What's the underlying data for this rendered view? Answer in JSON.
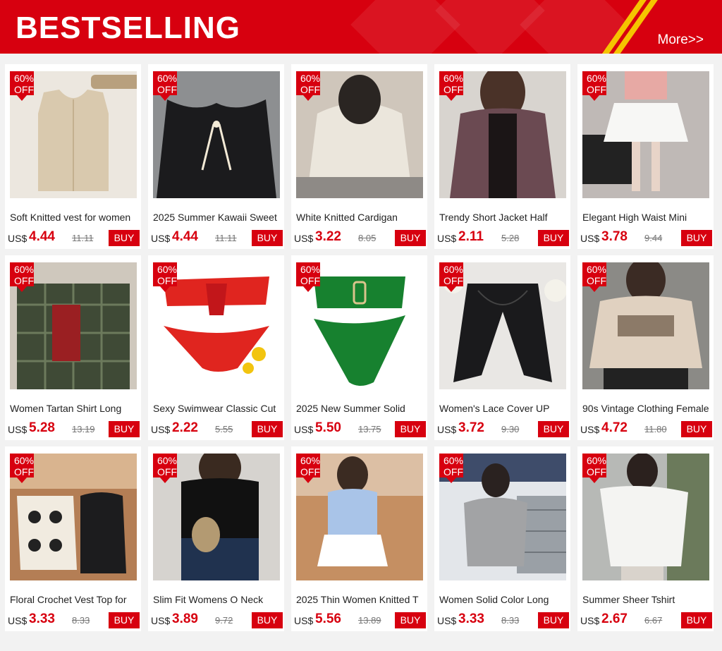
{
  "header": {
    "title": "BESTSELLING",
    "more_label": "More>>"
  },
  "colors": {
    "brand_red": "#d7000f",
    "accent_yellow": "#f5c400"
  },
  "badge": {
    "line1": "60%",
    "line2": "OFF"
  },
  "currency": "US$",
  "buy_label": "BUY",
  "products": [
    {
      "title": "Soft Knitted vest for women",
      "price": "4.44",
      "original_price": "11.11"
    },
    {
      "title": "2025 Summer Kawaii Sweet",
      "price": "4.44",
      "original_price": "11.11"
    },
    {
      "title": "White Knitted Cardigan",
      "price": "3.22",
      "original_price": "8.05"
    },
    {
      "title": "Trendy Short Jacket Half",
      "price": "2.11",
      "original_price": "5.28"
    },
    {
      "title": "Elegant High Waist Mini",
      "price": "3.78",
      "original_price": "9.44"
    },
    {
      "title": "Women Tartan Shirt Long",
      "price": "5.28",
      "original_price": "13.19"
    },
    {
      "title": "Sexy Swimwear Classic Cut",
      "price": "2.22",
      "original_price": "5.55"
    },
    {
      "title": "2025 New Summer Solid",
      "price": "5.50",
      "original_price": "13.75"
    },
    {
      "title": "Women's Lace Cover UP",
      "price": "3.72",
      "original_price": "9.30"
    },
    {
      "title": "90s Vintage Clothing Female",
      "price": "4.72",
      "original_price": "11.80"
    },
    {
      "title": "Floral Crochet Vest Top for",
      "price": "3.33",
      "original_price": "8.33"
    },
    {
      "title": "Slim Fit Womens O Neck",
      "price": "3.89",
      "original_price": "9.72"
    },
    {
      "title": "2025 Thin Women Knitted T",
      "price": "5.56",
      "original_price": "13.89"
    },
    {
      "title": "Women Solid Color Long",
      "price": "3.33",
      "original_price": "8.33"
    },
    {
      "title": "Summer Sheer Tshirt",
      "price": "2.67",
      "original_price": "6.67"
    }
  ]
}
